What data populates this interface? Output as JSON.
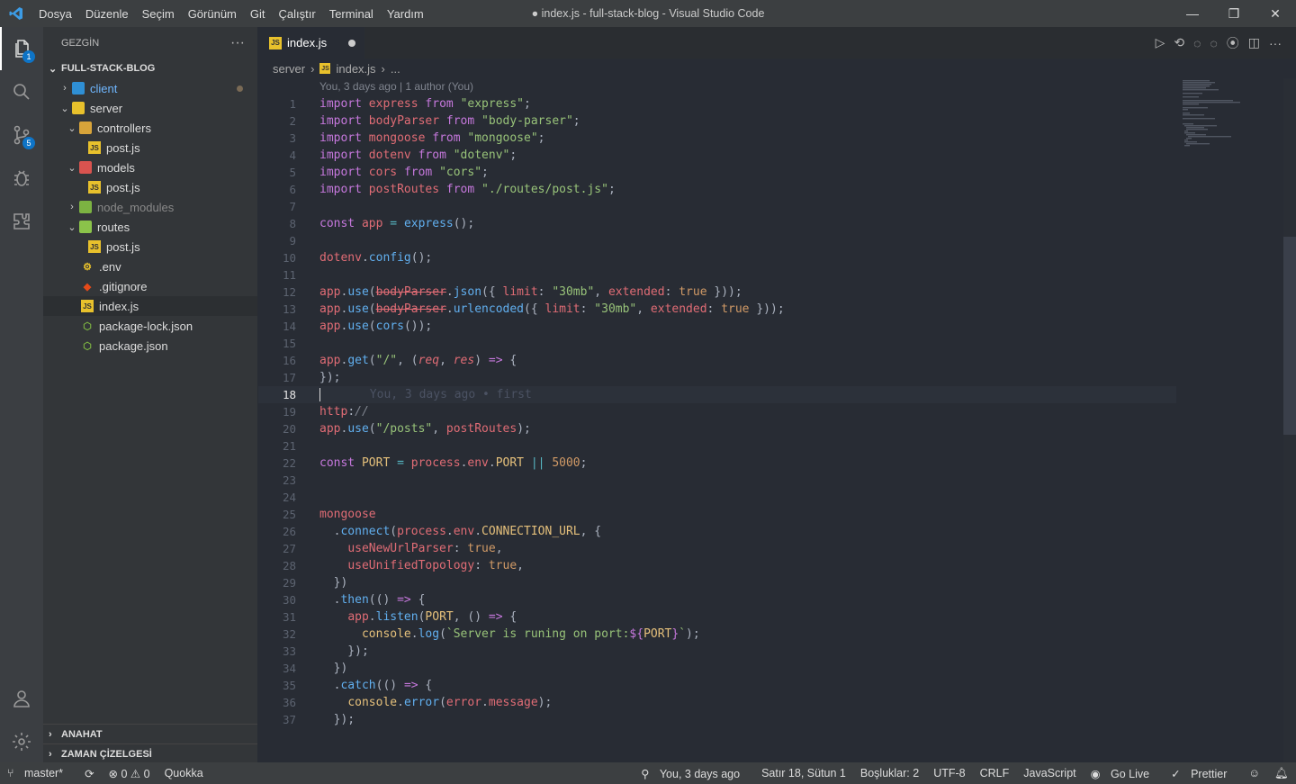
{
  "titlebar": {
    "menu": [
      "Dosya",
      "Düzenle",
      "Seçim",
      "Görünüm",
      "Git",
      "Çalıştır",
      "Terminal",
      "Yardım"
    ],
    "title": "● index.js - full-stack-blog - Visual Studio Code"
  },
  "activity": {
    "explorer_badge": "1",
    "scm_badge": "5"
  },
  "sidebar": {
    "header": "GEZGİN",
    "more": "···",
    "root": "FULL-STACK-BLOG",
    "items": [
      {
        "label": "client",
        "icon": "folder-client-icon"
      },
      {
        "label": "server",
        "icon": "folder-server-icon"
      },
      {
        "label": "controllers",
        "icon": "folder-controllers-icon"
      },
      {
        "label": "post.js",
        "icon": "js-file-icon"
      },
      {
        "label": "models",
        "icon": "folder-models-icon"
      },
      {
        "label": "post.js",
        "icon": "js-file-icon"
      },
      {
        "label": "node_modules",
        "icon": "folder-node-icon"
      },
      {
        "label": "routes",
        "icon": "folder-routes-icon"
      },
      {
        "label": "post.js",
        "icon": "js-file-icon"
      },
      {
        "label": ".env",
        "icon": "env-file-icon"
      },
      {
        "label": ".gitignore",
        "icon": "git-file-icon"
      },
      {
        "label": "index.js",
        "icon": "js-file-icon"
      },
      {
        "label": "package-lock.json",
        "icon": "node-file-icon"
      },
      {
        "label": "package.json",
        "icon": "node-file-icon"
      }
    ],
    "outline": "ANAHAT",
    "timeline": "ZAMAN ÇİZELGESİ"
  },
  "tab": {
    "label": "index.js"
  },
  "breadcrumb": {
    "folder": "server",
    "file": "index.js",
    "tail": "..."
  },
  "editor": {
    "blame_header": "You, 3 days ago | 1 author (You)",
    "inline_blame": "You, 3 days ago • first",
    "line_numbers": [
      "1",
      "2",
      "3",
      "4",
      "5",
      "6",
      "7",
      "8",
      "9",
      "10",
      "11",
      "12",
      "13",
      "14",
      "15",
      "16",
      "17",
      "18",
      "19",
      "20",
      "21",
      "22",
      "23",
      "24",
      "25",
      "26",
      "27",
      "28",
      "29",
      "30",
      "31",
      "32",
      "33",
      "34",
      "35",
      "36",
      "37"
    ],
    "current_line": "18"
  },
  "status": {
    "branch": "master*",
    "problems": "⊗ 0 ⚠ 0",
    "quokka": "Quokka",
    "blame": "You, 3 days ago",
    "position": "Satır 18, Sütun 1",
    "indent": "Boşluklar: 2",
    "encoding": "UTF-8",
    "eol": "CRLF",
    "language": "JavaScript",
    "golive": "Go Live",
    "prettier": "Prettier"
  }
}
